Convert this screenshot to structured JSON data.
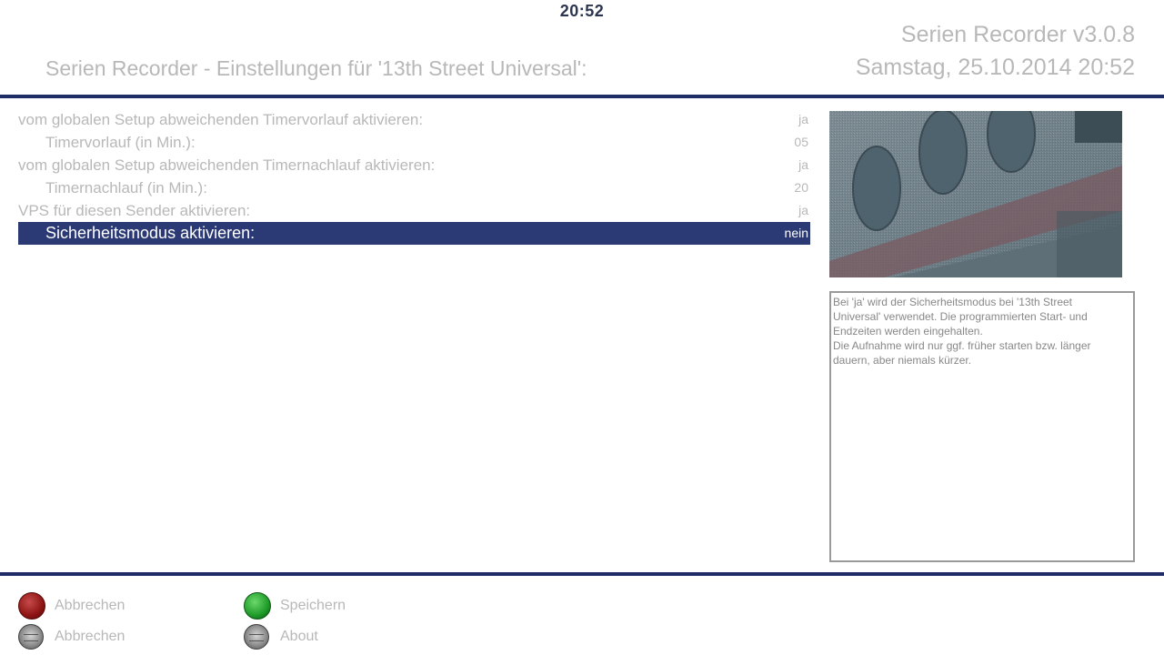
{
  "clock": "20:52",
  "header": {
    "version": "Serien Recorder v3.0.8",
    "title": "Serien Recorder - Einstellungen für '13th Street Universal':",
    "date": "Samstag, 25.10.2014  20:52"
  },
  "settings": [
    {
      "label": "vom globalen Setup abweichenden Timervorlauf aktivieren:",
      "value": "ja"
    },
    {
      "label": "Timervorlauf (in Min.):",
      "value": "05"
    },
    {
      "label": "vom globalen Setup abweichenden Timernachlauf aktivieren:",
      "value": "ja"
    },
    {
      "label": "Timernachlauf (in Min.):",
      "value": "20"
    },
    {
      "label": "VPS für diesen Sender aktivieren:",
      "value": "ja"
    },
    {
      "label": "Sicherheitsmodus aktivieren:",
      "value": "nein"
    }
  ],
  "description": {
    "text": "Bei 'ja' wird der Sicherheitsmodus bei '13th Street Universal' verwendet. Die programmierten Start- und Endzeiten werden eingehalten.\nDie Aufnahme wird nur ggf. früher starten bzw. länger dauern, aber niemals kürzer."
  },
  "footer": {
    "red_label": "Abbrechen",
    "green_label": "Speichern",
    "grey1_label": "Abbrechen",
    "grey2_label": "About"
  },
  "colors": {
    "accent_bar": "#1f2d66",
    "selection": "#2b3a74",
    "text": "#b8b8b8"
  }
}
